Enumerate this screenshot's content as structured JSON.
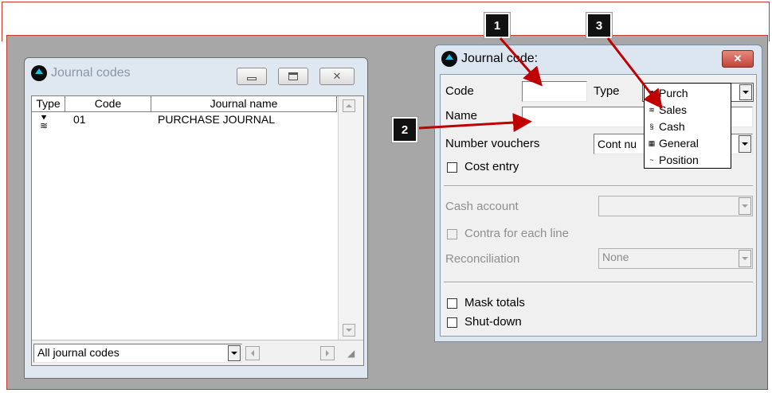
{
  "journal_codes_window": {
    "title": "Journal codes",
    "columns": [
      "Type",
      "Code",
      "Journal name"
    ],
    "rows": [
      {
        "type_icon": "purchase-journal-icon",
        "code": "01",
        "journal_name": "PURCHASE JOURNAL"
      }
    ],
    "filter_value": "All journal codes"
  },
  "journal_code_dialog": {
    "title": "Journal code:",
    "code_label": "Code",
    "code_value": "",
    "type_label": "Type",
    "type_selected": "Purch",
    "type_options": [
      {
        "label": "Purch",
        "icon": "purchase-icon"
      },
      {
        "label": "Sales",
        "icon": "sales-icon"
      },
      {
        "label": "Cash",
        "icon": "cash-icon"
      },
      {
        "label": "General",
        "icon": "general-icon"
      },
      {
        "label": "Position",
        "icon": "position-icon"
      }
    ],
    "name_label": "Name",
    "name_value": "",
    "number_vouchers_label": "Number vouchers",
    "number_vouchers_value": "Cont nu",
    "cost_entry_label": "Cost entry",
    "cash_account_label": "Cash account",
    "cash_account_value": "",
    "contra_label": "Contra for each line",
    "reconciliation_label": "Reconciliation",
    "reconciliation_value": "None",
    "mask_totals_label": "Mask totals",
    "shut_down_label": "Shut-down"
  },
  "callouts": [
    "1",
    "2",
    "3"
  ],
  "colors": {
    "annotation_arrow": "#c00000",
    "frame_border": "#c0392b",
    "desktop": "#a7a7a7",
    "close_button": "#d9534f",
    "title_icon_arrow": "#1fc0e8"
  }
}
